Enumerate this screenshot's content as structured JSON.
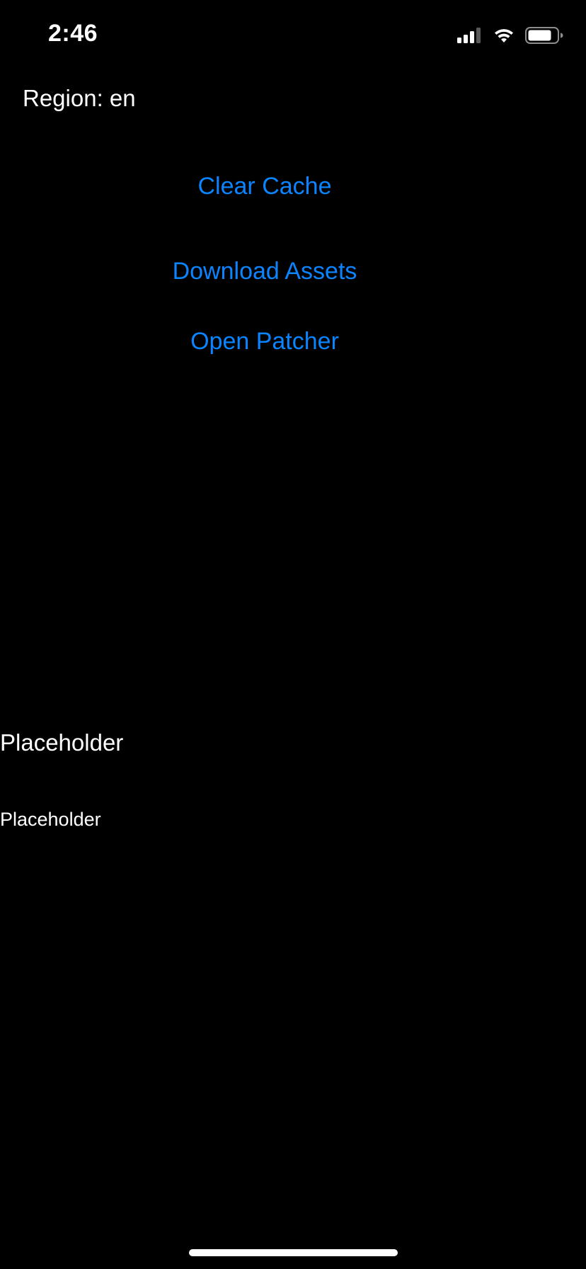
{
  "status_bar": {
    "time": "2:46",
    "icons": [
      "cellular-signal-icon",
      "wifi-icon",
      "battery-icon"
    ]
  },
  "region": {
    "label": "Region: en"
  },
  "actions": {
    "clear_cache": "Clear Cache",
    "download_assets": "Download Assets",
    "open_patcher": "Open Patcher"
  },
  "placeholders": {
    "large": "Placeholder",
    "small": "Placeholder"
  },
  "colors": {
    "background": "#000000",
    "text": "#FFFFFF",
    "accent": "#0A84FF"
  }
}
